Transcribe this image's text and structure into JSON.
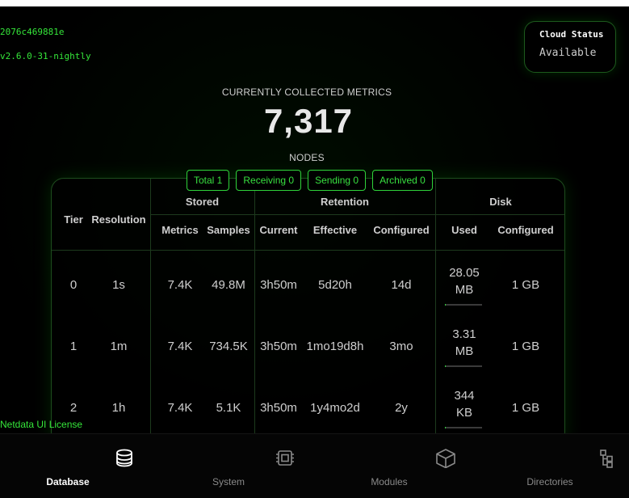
{
  "build": {
    "hash": "2076c469881e",
    "version": "v2.6.0-31-nightly"
  },
  "cloud": {
    "title": "Cloud Status",
    "value": "Available"
  },
  "metrics": {
    "heading": "CURRENTLY COLLECTED METRICS",
    "count": "7,317",
    "nodes_label": "NODES"
  },
  "badges": [
    "Total 1",
    "Receiving 0",
    "Sending 0",
    "Archived 0"
  ],
  "table": {
    "group_headers": {
      "stored": "Stored",
      "retention": "Retention",
      "disk": "Disk"
    },
    "columns": {
      "tier": "Tier",
      "resolution": "Resolution",
      "metrics": "Metrics",
      "samples": "Samples",
      "current": "Current",
      "effective": "Effective",
      "configured": "Configured",
      "used": "Used",
      "disk_configured": "Configured"
    },
    "rows": [
      {
        "tier": "0",
        "resolution": "1s",
        "metrics": "7.4K",
        "samples": "49.8M",
        "current": "3h50m",
        "effective": "5d20h",
        "configured": "14d",
        "used_value": "28.05",
        "used_unit": "MB",
        "used_fraction": 0.03,
        "disk_configured": "1 GB"
      },
      {
        "tier": "1",
        "resolution": "1m",
        "metrics": "7.4K",
        "samples": "734.5K",
        "current": "3h50m",
        "effective": "1mo19d8h",
        "configured": "3mo",
        "used_value": "3.31",
        "used_unit": "MB",
        "used_fraction": 0.004,
        "disk_configured": "1 GB"
      },
      {
        "tier": "2",
        "resolution": "1h",
        "metrics": "7.4K",
        "samples": "5.1K",
        "current": "3h50m",
        "effective": "1y4mo2d",
        "configured": "2y",
        "used_value": "344",
        "used_unit": "KB",
        "used_fraction": 0.001,
        "disk_configured": "1 GB"
      }
    ]
  },
  "license": "Netdata UI License",
  "nav": [
    {
      "label": "Database",
      "icon": "database-icon",
      "active": true
    },
    {
      "label": "System",
      "icon": "chip-icon",
      "active": false
    },
    {
      "label": "Modules",
      "icon": "cube-icon",
      "active": false
    },
    {
      "label": "Directories",
      "icon": "directory-tree-icon",
      "active": false
    }
  ],
  "colors": {
    "accent": "#2fd33a",
    "background": "#000000"
  }
}
